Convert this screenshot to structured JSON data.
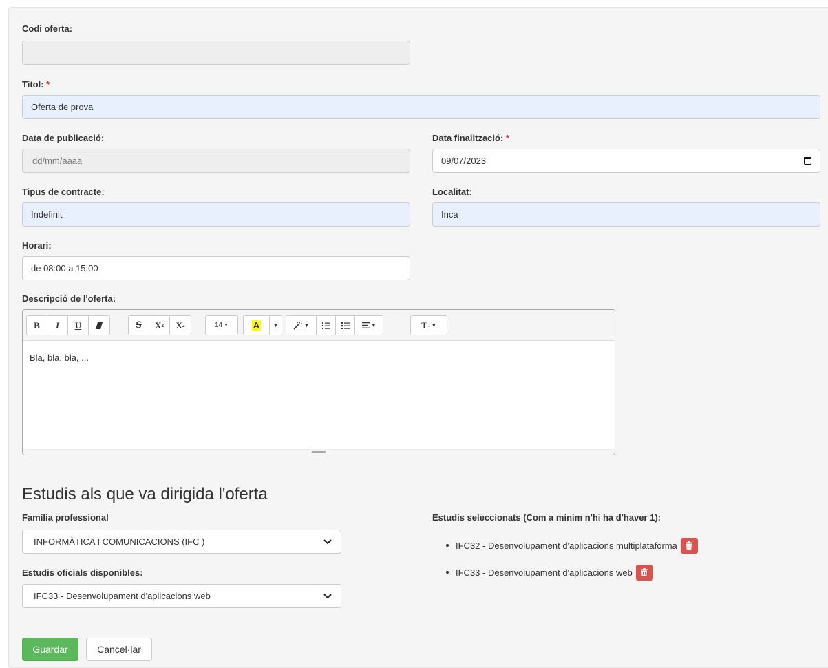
{
  "form": {
    "codi": {
      "label": "Codi oferta:",
      "value": ""
    },
    "titol": {
      "label": "Titol:",
      "required": "*",
      "value": "Oferta de prova"
    },
    "data_publicacio": {
      "label": "Data de publicació:",
      "placeholder": "dd/mm/aaaa"
    },
    "data_finalitzacio": {
      "label": "Data finalització:",
      "required": "*",
      "value": "09/07/2023"
    },
    "tipus_contracte": {
      "label": "Tipus de contracte:",
      "value": "Indefinit"
    },
    "localitat": {
      "label": "Localitat:",
      "value": "Inca"
    },
    "horari": {
      "label": "Horari:",
      "value": "de 08:00 a 15:00"
    },
    "descripcio": {
      "label": "Descripció de l'oferta:",
      "text": "Bla, bla, bla, ..."
    }
  },
  "editor_toolbar": {
    "bold": "B",
    "italic": "I",
    "underline": "U",
    "strike": "S",
    "superscript": "X",
    "subscript": "X",
    "font_size": "14",
    "highlight": "A",
    "text_style": "T",
    "highlight_color": "#ffff00"
  },
  "studies": {
    "heading": "Estudis als que va dirigida l'oferta",
    "familia_label": "Família professional",
    "familia_value": "INFORMÀTICA I COMUNICACIONS (IFC )",
    "oficials_label": "Estudis oficials disponibles:",
    "oficials_value": "IFC33 - Desenvolupament d'aplicacions web",
    "selected_label": "Estudis seleccionats (Com a mínim n'hi ha d'haver 1):",
    "selected": [
      "IFC32 - Desenvolupament d'aplicacions multiplataforma",
      "IFC33 - Desenvolupament d'aplicacions web"
    ]
  },
  "actions": {
    "save": "Guardar",
    "cancel": "Cancel·lar"
  },
  "colors": {
    "save": "#5cb85c",
    "delete": "#d9534f",
    "autofill": "#e8f0fe",
    "required": "#e02424"
  }
}
